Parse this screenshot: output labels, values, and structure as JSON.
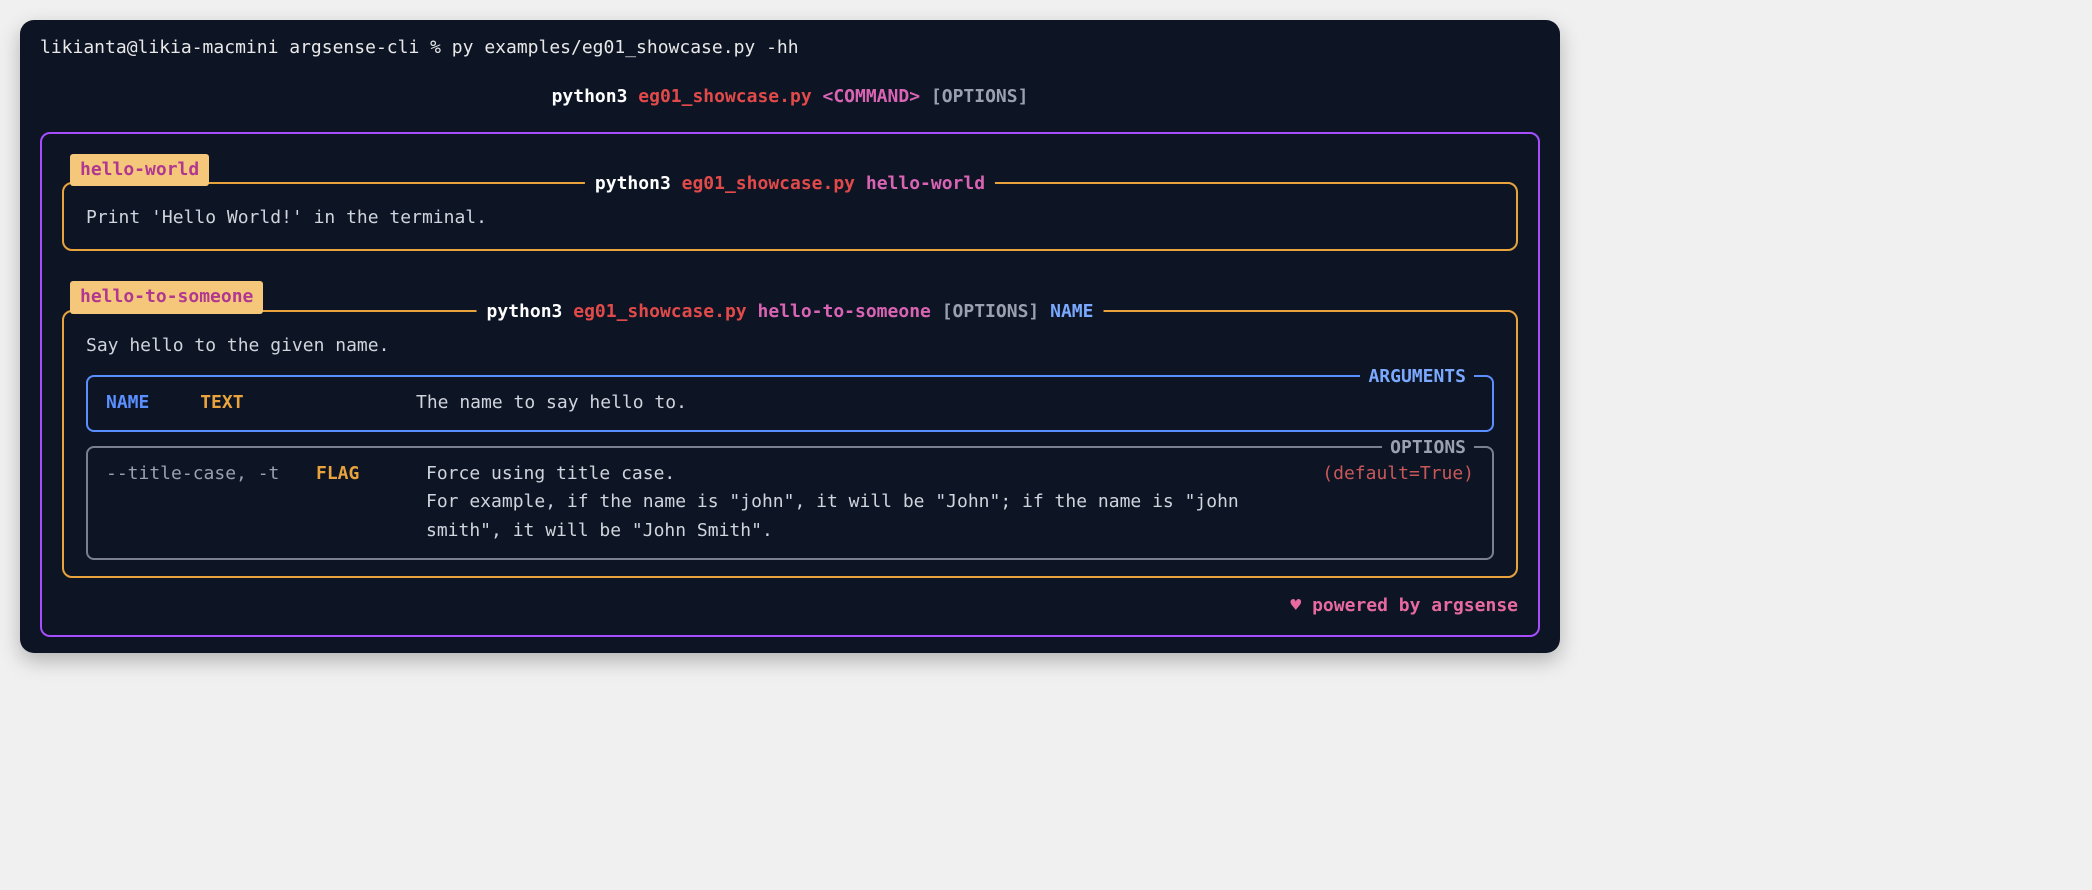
{
  "prompt": "likianta@likia-macmini argsense-cli % py examples/eg01_showcase.py -hh",
  "usage": {
    "interpreter": "python3",
    "script": "eg01_showcase.py",
    "command": "<COMMAND>",
    "options": "[OPTIONS]"
  },
  "commands": [
    {
      "name": "hello-world",
      "title": {
        "interpreter": "python3",
        "script": "eg01_showcase.py",
        "cmd": "hello-world"
      },
      "description": "Print 'Hello World!' in the terminal."
    },
    {
      "name": "hello-to-someone",
      "title": {
        "interpreter": "python3",
        "script": "eg01_showcase.py",
        "cmd": "hello-to-someone",
        "options": "[OPTIONS]",
        "arg": "NAME"
      },
      "description": "Say hello to the given name.",
      "arguments_label": "ARGUMENTS",
      "arguments": [
        {
          "name": "NAME",
          "type": "TEXT",
          "desc": "The name to say hello to."
        }
      ],
      "options_label": "OPTIONS",
      "options": [
        {
          "name": "--title-case, -t",
          "type": "FLAG",
          "desc_line1": "Force using title case.",
          "desc_line2": "For example, if the name is \"john\", it will be \"John\"; if the name is \"john smith\", it will be \"John Smith\".",
          "default": "(default=True)"
        }
      ]
    }
  ],
  "footer": {
    "heart": "♥",
    "text": "powered by argsense"
  }
}
